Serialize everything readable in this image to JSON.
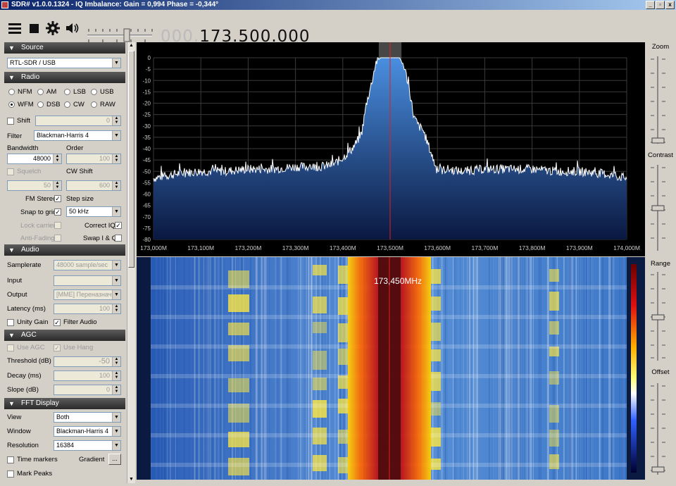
{
  "window": {
    "title": "SDR# v1.0.0.1324 - IQ Imbalance: Gain = 0,994 Phase = -0,344°",
    "buttons": [
      "_",
      "▫",
      "x"
    ]
  },
  "toolbar": {
    "frequency_dim": "000.",
    "frequency_active": "173.500.000",
    "icons": [
      "menu-icon",
      "stop-icon",
      "gear-icon",
      "speaker-icon"
    ]
  },
  "source": {
    "header": "Source",
    "device": "RTL-SDR / USB"
  },
  "radio": {
    "header": "Radio",
    "modes": [
      "NFM",
      "AM",
      "LSB",
      "USB",
      "WFM",
      "DSB",
      "CW",
      "RAW"
    ],
    "selected_mode": "WFM",
    "shift_label": "Shift",
    "shift_value": "0",
    "filter_label": "Filter",
    "filter_value": "Blackman-Harris 4",
    "bandwidth_label": "Bandwidth",
    "bandwidth_value": "48000",
    "order_label": "Order",
    "order_value": "100",
    "squelch_label": "Squelch",
    "squelch_value": "50",
    "cwshift_label": "CW Shift",
    "cwshift_value": "600",
    "fmstereo_label": "FM Stereo",
    "fmstereo_checked": "✓",
    "stepsize_label": "Step size",
    "snap_label": "Snap to grid",
    "snap_checked": "✓",
    "step_value": "50 kHz",
    "lockcarrier_label": "Lock carrier",
    "correctiq_label": "Correct IQ",
    "correctiq_checked": "✓",
    "antifading_label": "Anti-Fading",
    "swapiq_label": "Swap I & Q"
  },
  "audio": {
    "header": "Audio",
    "samplerate_label": "Samplerate",
    "samplerate_value": "48000 sample/sec",
    "input_label": "Input",
    "input_value": "",
    "output_label": "Output",
    "output_value": "[MME] Переназначен",
    "latency_label": "Latency (ms)",
    "latency_value": "100",
    "unitygain_label": "Unity Gain",
    "filteraudio_label": "Filter Audio",
    "filteraudio_checked": "✓"
  },
  "agc": {
    "header": "AGC",
    "useagc_label": "Use AGC",
    "usehang_label": "Use Hang",
    "usehang_checked": "✓",
    "threshold_label": "Threshold (dB)",
    "threshold_value": "-50",
    "decay_label": "Decay (ms)",
    "decay_value": "100",
    "slope_label": "Slope (dB)",
    "slope_value": "0"
  },
  "fft": {
    "header": "FFT Display",
    "view_label": "View",
    "view_value": "Both",
    "window_label": "Window",
    "window_value": "Blackman-Harris 4",
    "resolution_label": "Resolution",
    "resolution_value": "16384",
    "timemarkers_label": "Time markers",
    "gradient_label": "Gradient",
    "gradient_btn": "...",
    "markpeaks_label": "Mark Peaks"
  },
  "right": {
    "zoom_label": "Zoom",
    "contrast_label": "Contrast",
    "range_label": "Range",
    "offset_label": "Offset"
  },
  "waterfall": {
    "marker_label": "173,450MHz"
  },
  "chart_data": {
    "type": "line",
    "xlabel": "",
    "ylabel": "",
    "ylim": [
      -80,
      0
    ],
    "y_ticks": [
      "0",
      "-5",
      "-10",
      "-15",
      "-20",
      "-25",
      "-30",
      "-35",
      "-40",
      "-45",
      "-50",
      "-55",
      "-60",
      "-65",
      "-70",
      "-75",
      "-80"
    ],
    "x_ticks": [
      "173,000M",
      "173,100M",
      "173,200M",
      "173,300M",
      "173,400M",
      "173,500M",
      "173,600M",
      "173,700M",
      "173,800M",
      "173,900M",
      "174,000M"
    ],
    "xlim_mhz": [
      173.0,
      174.0
    ],
    "center_mhz": 173.5,
    "passband_mhz": [
      173.476,
      173.524
    ],
    "grid": true,
    "trace_color": "#ffffff",
    "fill_color": "#2a6fc0",
    "series": [
      {
        "x": [
          173.0,
          173.05,
          173.1,
          173.15,
          173.2,
          173.25,
          173.3,
          173.35,
          173.38,
          173.4,
          173.42,
          173.43,
          173.44,
          173.45,
          173.46,
          173.47,
          173.48,
          173.49,
          173.5,
          173.51,
          173.52,
          173.53,
          173.54,
          173.55,
          173.56,
          173.57,
          173.58,
          173.6,
          173.62,
          173.65,
          173.7,
          173.75,
          173.8,
          173.85,
          173.9,
          173.95,
          174.0
        ],
        "values": [
          -53,
          -51,
          -50,
          -50,
          -49,
          -49,
          -48,
          -48,
          -47,
          -44,
          -40,
          -37,
          -33,
          -20,
          -12,
          -2,
          0,
          0,
          0,
          0,
          0,
          -4,
          -13,
          -26,
          -30,
          -32,
          -38,
          -50,
          -49,
          -50,
          -49,
          -49,
          -49,
          -50,
          -50,
          -51,
          -53
        ]
      }
    ]
  }
}
